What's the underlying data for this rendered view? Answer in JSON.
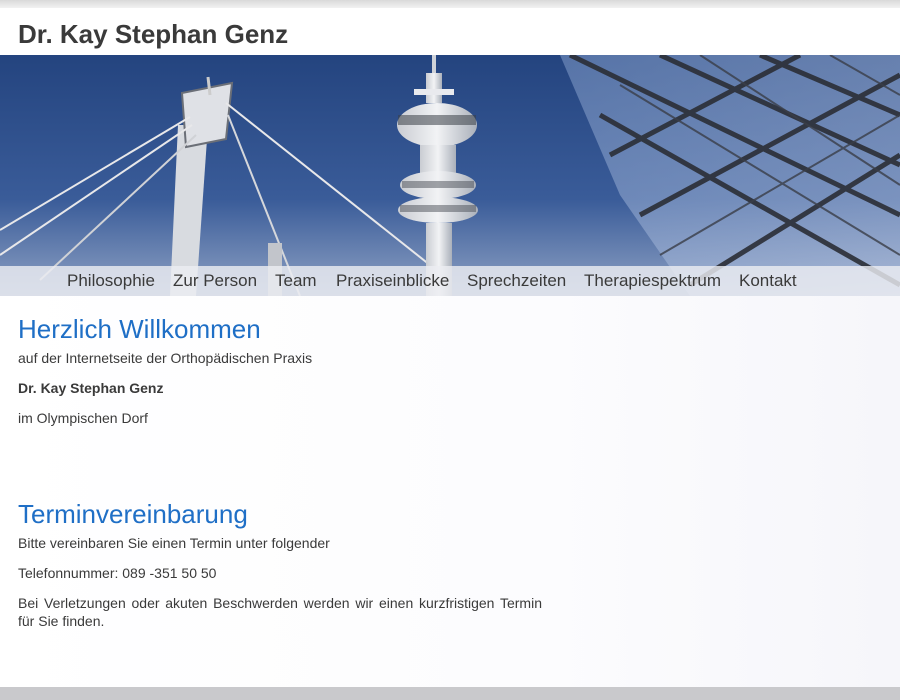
{
  "site": {
    "title": "Dr. Kay Stephan Genz"
  },
  "nav": {
    "items": [
      {
        "label": "Philosophie"
      },
      {
        "label": "Zur Person"
      },
      {
        "label": "Team"
      },
      {
        "label": "Praxiseinblicke"
      },
      {
        "label": "Sprechzeiten"
      },
      {
        "label": "Therapiespektrum"
      },
      {
        "label": "Kontakt"
      }
    ]
  },
  "welcome": {
    "heading": "Herzlich Willkommen",
    "line1": "auf der Internetseite der Orthopädischen Praxis",
    "name": "Dr. Kay Stephan Genz",
    "line3": "im Olympischen Dorf"
  },
  "appointment": {
    "heading": "Terminvereinbarung",
    "line1": "Bitte vereinbaren Sie einen Termin unter folgender",
    "phone": "Telefonnummer: 089 -351 50 50",
    "note": "Bei Verletzungen oder akuten Beschwerden werden wir einen kurzfristigen Termin für Sie finden."
  },
  "colors": {
    "heading": "#1f6fc6",
    "sky": "#2d4f8e",
    "text": "#3a3a3a"
  }
}
